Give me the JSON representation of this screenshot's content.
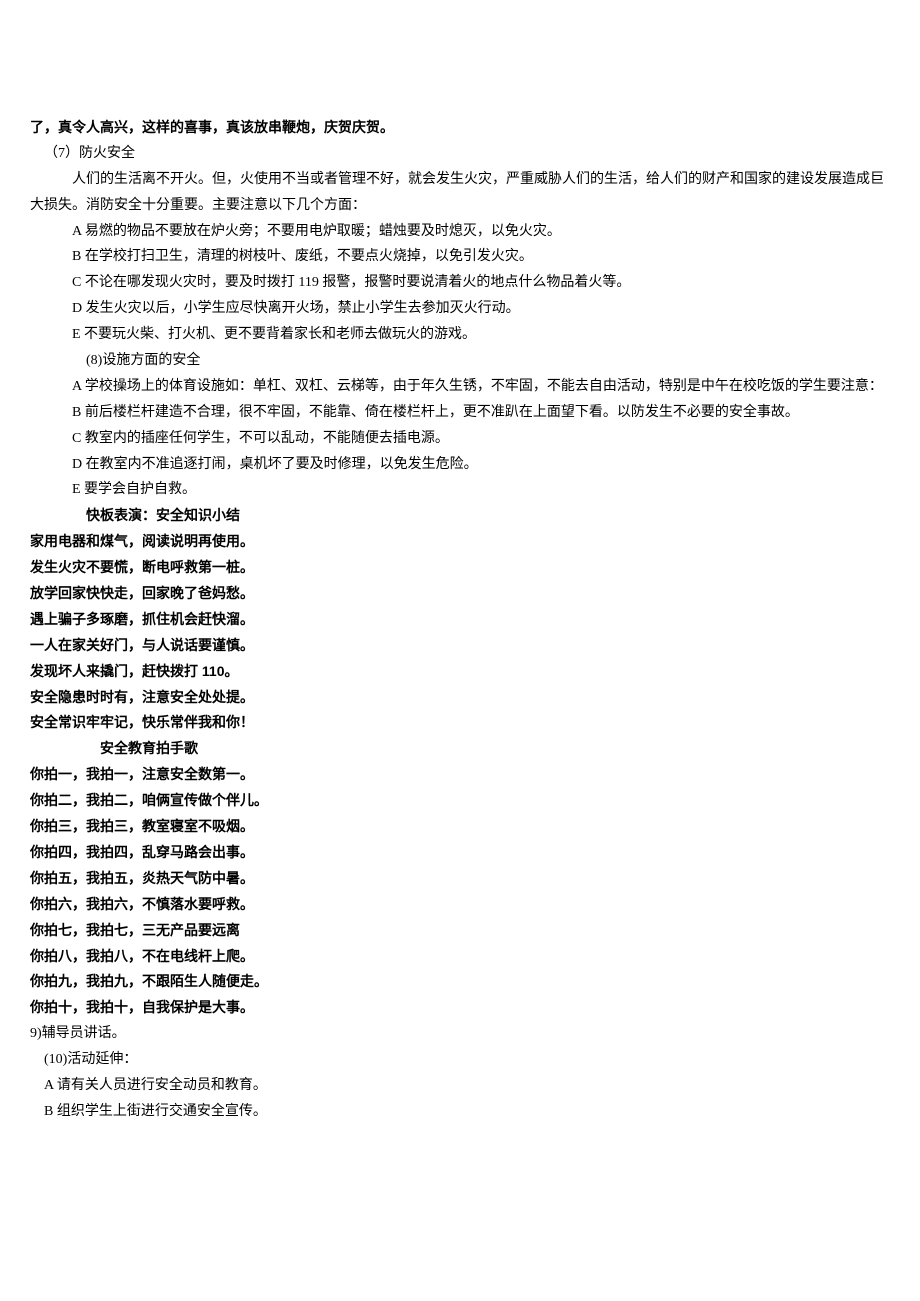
{
  "intro_bold": "了，真令人高兴，这样的喜事，真该放串鞭炮，庆贺庆贺。",
  "s7": {
    "title": "（7）防火安全",
    "p1": "人们的生活离不开火。但，火使用不当或者管理不好，就会发生火灾，严重威胁人们的生活，给人们的财产和国家的建设发展造成巨大损失。消防安全十分重要。主要注意以下几个方面：",
    "A": "A 易燃的物品不要放在炉火旁；不要用电炉取暖；蜡烛要及时熄灭，以免火灾。",
    "B": "B 在学校打扫卫生，清理的树枝叶、废纸，不要点火烧掉，以免引发火灾。",
    "C": "C 不论在哪发现火灾时，要及时拨打 119 报警，报警时要说清着火的地点什么物品着火等。",
    "D": "D 发生火灾以后，小学生应尽快离开火场，禁止小学生去参加灭火行动。",
    "E": "E 不要玩火柴、打火机、更不要背着家长和老师去做玩火的游戏。"
  },
  "s8": {
    "title": "(8)设施方面的安全",
    "A": "A 学校操场上的体育设施如：单杠、双杠、云梯等，由于年久生锈，不牢固，不能去自由活动，特别是中午在校吃饭的学生要注意：",
    "B": "B 前后楼栏杆建造不合理，很不牢固，不能靠、倚在楼栏杆上，更不准趴在上面望下看。以防发生不必要的安全事故。",
    "C": "C 教室内的插座任何学生，不可以乱动，不能随便去插电源。",
    "D": "D 在教室内不准追逐打闹，桌机坏了要及时修理，以免发生危险。",
    "E": "E 要学会自护自救。"
  },
  "kuaiban": {
    "title": "快板表演：安全知识小结",
    "lines": [
      "家用电器和煤气，阅读说明再使用。",
      "发生火灾不要慌，断电呼救第一桩。",
      "放学回家快快走，回家晚了爸妈愁。",
      "遇上骗子多琢磨，抓住机会赶快溜。",
      "一人在家关好门，与人说话要谨慎。",
      "发现坏人来撬门，赶快拨打 110。",
      "安全隐患时时有，注意安全处处提。",
      "安全常识牢牢记，快乐常伴我和你！"
    ]
  },
  "paishouge": {
    "title": "安全教育拍手歌",
    "lines": [
      "你拍一，我拍一，注意安全数第一。",
      "你拍二，我拍二，咱俩宣传做个伴儿。",
      "你拍三，我拍三，教室寝室不吸烟。",
      "你拍四，我拍四，乱穿马路会出事。",
      "你拍五，我拍五，炎热天气防中暑。",
      "你拍六，我拍六，不慎落水要呼救。",
      "你拍七，我拍七，三无产品要远离",
      "你拍八，我拍八，不在电线杆上爬。",
      "你拍九，我拍九，不跟陌生人随便走。",
      "你拍十，我拍十，自我保护是大事。"
    ]
  },
  "s9": "9)辅导员讲话。",
  "s10": {
    "title": "(10)活动延伸：",
    "A": "A 请有关人员进行安全动员和教育。",
    "B": "B 组织学生上街进行交通安全宣传。"
  }
}
